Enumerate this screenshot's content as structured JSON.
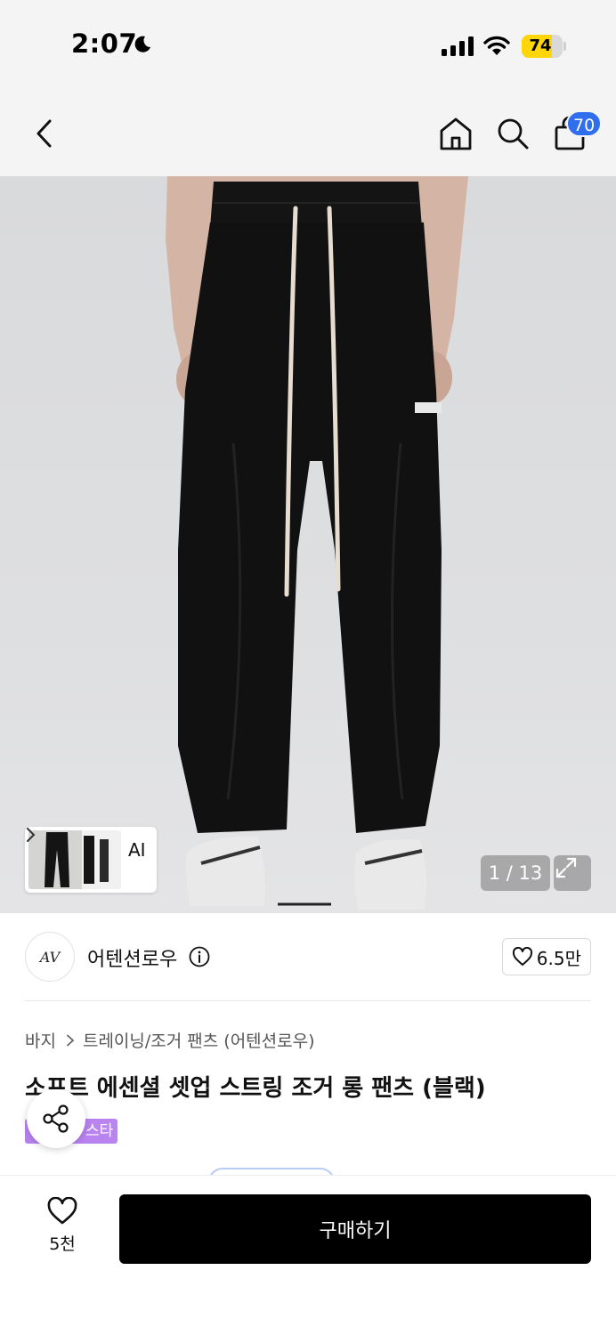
{
  "status_bar": {
    "time": "2:07",
    "battery_level": "74",
    "battery_fraction": 0.74
  },
  "nav": {
    "cart_count": "70",
    "icons": [
      "back-arrow-icon",
      "home-icon",
      "search-icon",
      "shopping-bag-icon"
    ]
  },
  "gallery": {
    "counter": "1 / 13",
    "ai_label": "AI"
  },
  "brand": {
    "logo_text": "AV",
    "name": "어텐션로우",
    "like_count": "6.5만"
  },
  "product": {
    "breadcrumb": [
      "바지",
      "트레이닝/조거 팬츠 (어텐션로우)"
    ],
    "title": "소프트 에센셜 셋업 스트링 조거 롱 팬츠 (블랙)",
    "tag": "스타"
  },
  "bottom_bar": {
    "wish_count": "5천",
    "buy_label": "구매하기"
  },
  "colors": {
    "badge_blue": "#2f6fed",
    "tag_purple": "#b983f0",
    "buy_button": "#000000",
    "battery": "#ffd60a"
  }
}
